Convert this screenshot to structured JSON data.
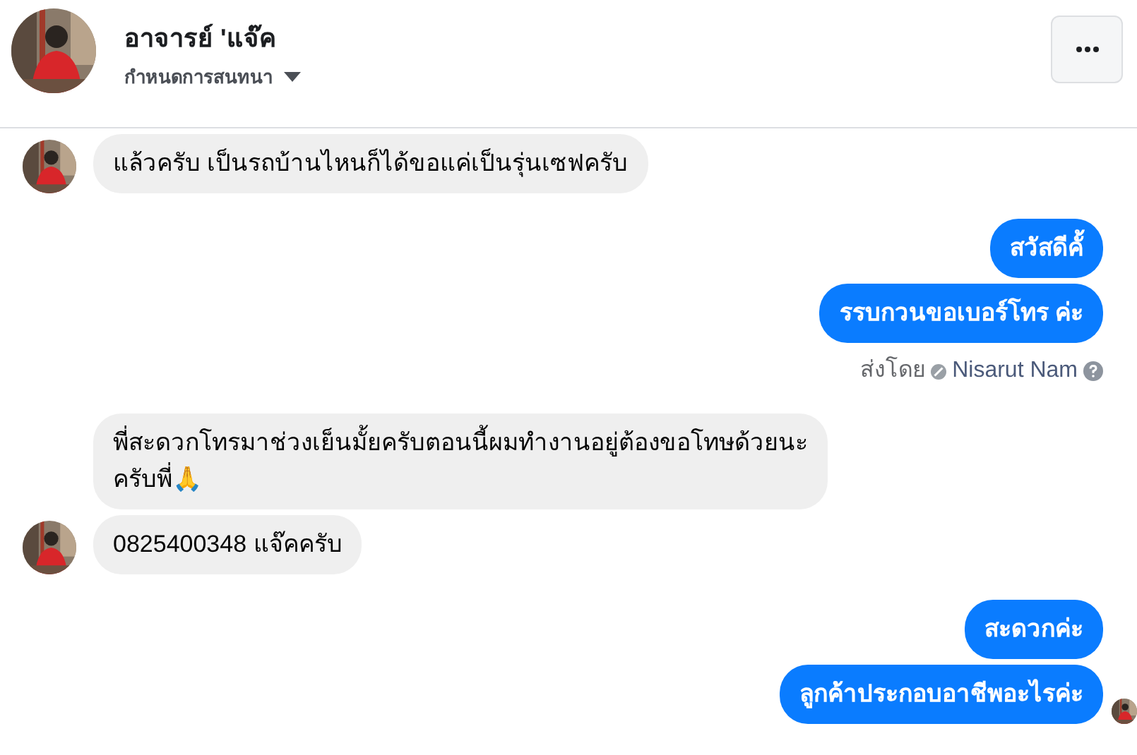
{
  "header": {
    "name": "อาจารย์ 'แจ๊ค",
    "subtitle": "กำหนดการสนทนา"
  },
  "groups": [
    {
      "kind": "incoming",
      "bubbles": [
        "แล้วครับ เป็นรถบ้านไหนก็ได้ขอแค่เป็นรุ่นเซฟครับ"
      ]
    },
    {
      "kind": "outgoing",
      "bubbles": [
        "สวัสดีคั้",
        "รรบกวนขอเบอร์โทร ค่ะ"
      ],
      "sent_by": {
        "prefix": "ส่งโดย",
        "name": "Nisarut Nam"
      },
      "seen": false
    },
    {
      "kind": "incoming",
      "bubbles": [
        "พี่สะดวกโทรมาช่วงเย็นมั้ยครับตอนนี้ผมทำงานอยู่ต้องขอโทษด้วยนะครับพี่🙏",
        "0825400348 แจ๊คครับ"
      ]
    },
    {
      "kind": "outgoing",
      "bubbles": [
        "สะดวกค่ะ",
        "ลูกค้าประกอบอาชีพอะไรค่ะ"
      ],
      "seen": true
    }
  ]
}
